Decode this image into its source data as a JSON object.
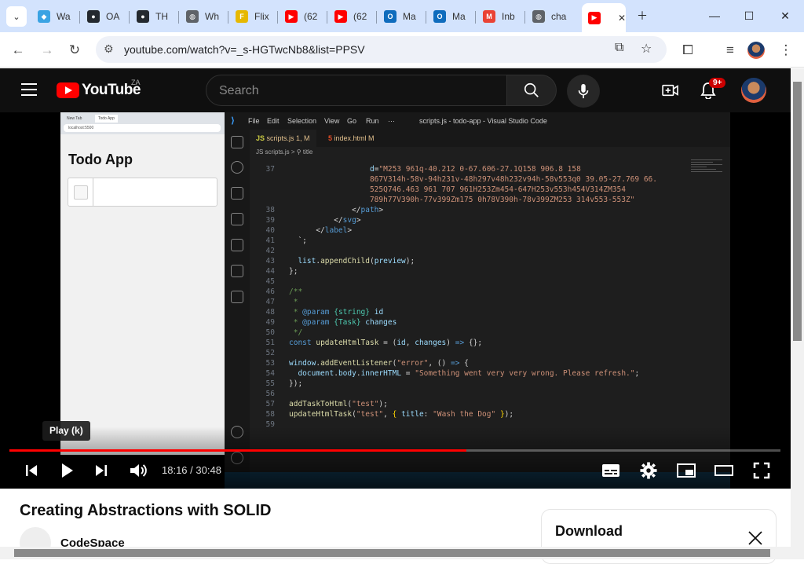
{
  "browser": {
    "tabs": [
      {
        "label": "Wa",
        "icon": "tab-favicon-diamond",
        "color": "#3aa3e3"
      },
      {
        "label": "OA",
        "icon": "github-icon",
        "color": "#24292f"
      },
      {
        "label": "TH",
        "icon": "github-icon",
        "color": "#24292f"
      },
      {
        "label": "Wh",
        "icon": "globe-icon",
        "color": "#5f6368"
      },
      {
        "label": "Flix",
        "icon": "flix-icon",
        "color": "#e6b800"
      },
      {
        "label": "(62",
        "icon": "youtube-icon",
        "color": "#ff0000"
      },
      {
        "label": "(62",
        "icon": "youtube-icon",
        "color": "#ff0000"
      },
      {
        "label": "Ma",
        "icon": "outlook-icon",
        "color": "#0f6cbd"
      },
      {
        "label": "Ma",
        "icon": "outlook-icon",
        "color": "#0f6cbd"
      },
      {
        "label": "Inb",
        "icon": "gmail-icon",
        "color": "#ea4335"
      },
      {
        "label": "cha",
        "icon": "globe-icon",
        "color": "#5f6368"
      },
      {
        "label": "",
        "icon": "youtube-icon",
        "color": "#ff0000"
      }
    ],
    "url": "youtube.com/watch?v=_s-HGTwcNb8&list=PPSV"
  },
  "youtube": {
    "logo_text": "YouTube",
    "region": "ZA",
    "search_placeholder": "Search",
    "notification_count": "9+",
    "accent": "#ff0000"
  },
  "video": {
    "todo_app": {
      "title": "Todo App",
      "mini_tabs": [
        "New Tab",
        "Todo App"
      ],
      "mini_url": "localhost:5500"
    },
    "vscode": {
      "window_title": "scripts.js - todo-app - Visual Studio Code",
      "menu": [
        "File",
        "Edit",
        "Selection",
        "View",
        "Go",
        "Run",
        "···"
      ],
      "tabs": [
        {
          "label": "scripts.js 1, M",
          "prefix": "JS"
        },
        {
          "label": "index.html M",
          "prefix": "5"
        }
      ],
      "breadcrumb": "JS scripts.js > ⚲ title"
    },
    "tooltip": "Play (k)",
    "time_current": "18:16",
    "time_total": "30:48",
    "progress_fraction": 0.593
  },
  "below": {
    "title": "Creating Abstractions with SOLID",
    "channel": "CodeSpace",
    "download_title": "Download"
  }
}
